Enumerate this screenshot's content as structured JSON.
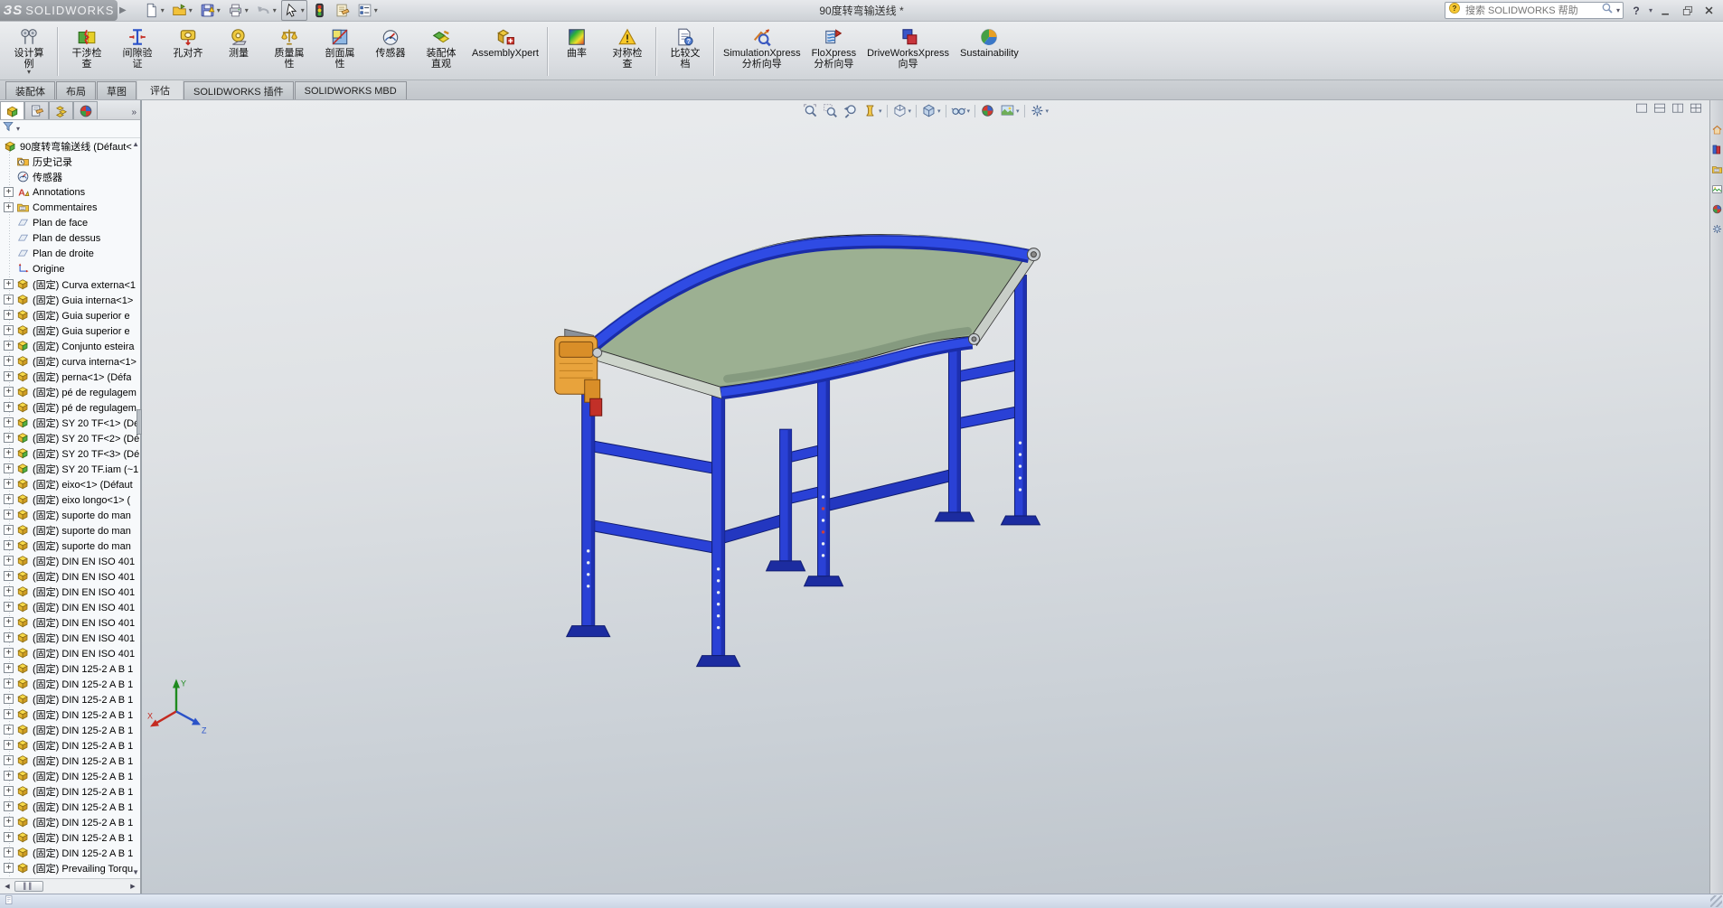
{
  "titlebar": {
    "logo_mark": "ЗS",
    "logo_text": "SOLIDWORKS",
    "document_title": "90度转弯输送线 *",
    "tools": [
      {
        "name": "new-document",
        "icon": "newdoc",
        "dropdown": true
      },
      {
        "name": "open",
        "icon": "open",
        "dropdown": true
      },
      {
        "name": "save",
        "icon": "save",
        "dropdown": true
      },
      {
        "name": "print",
        "icon": "print",
        "dropdown": true
      },
      {
        "name": "undo",
        "icon": "undo",
        "dropdown": true
      },
      {
        "name": "select",
        "icon": "cursor",
        "dropdown": true,
        "pressed": true
      },
      {
        "name": "rebuild",
        "icon": "rebuild",
        "dropdown": false
      },
      {
        "name": "file-properties",
        "icon": "fileprops",
        "dropdown": false
      },
      {
        "name": "options",
        "icon": "options",
        "dropdown": true
      }
    ],
    "search": {
      "placeholder": "搜索 SOLIDWORKS 帮助"
    },
    "help_label": "?"
  },
  "ribbon": {
    "buttons": [
      {
        "name": "design-study",
        "lines": [
          "设计算",
          "例"
        ],
        "icon": "designstudy",
        "flyout": true,
        "sep_after": true
      },
      {
        "name": "interference-check",
        "lines": [
          "干涉检",
          "查"
        ],
        "icon": "interfer"
      },
      {
        "name": "clearance-verify",
        "lines": [
          "间隙验",
          "证"
        ],
        "icon": "clearance"
      },
      {
        "name": "hole-alignment",
        "lines": [
          "孔对齐"
        ],
        "icon": "holealign"
      },
      {
        "name": "measure",
        "lines": [
          "测量"
        ],
        "icon": "measure"
      },
      {
        "name": "mass-properties",
        "lines": [
          "质量属",
          "性"
        ],
        "icon": "massprops"
      },
      {
        "name": "section-properties",
        "lines": [
          "剖面属",
          "性"
        ],
        "icon": "sectprops"
      },
      {
        "name": "sensor",
        "lines": [
          "传感器"
        ],
        "icon": "sensor"
      },
      {
        "name": "assembly-visualize",
        "lines": [
          "装配体",
          "直观"
        ],
        "icon": "asmvis"
      },
      {
        "name": "assembly-xpert",
        "lines": [
          "AssemblyXpert"
        ],
        "icon": "asmxpert",
        "sep_after": true
      },
      {
        "name": "curvature",
        "lines": [
          "曲率"
        ],
        "icon": "curvature"
      },
      {
        "name": "symmetry-check",
        "lines": [
          "对称检",
          "查"
        ],
        "icon": "symcheck",
        "sep_after": true
      },
      {
        "name": "compare-documents",
        "lines": [
          "比较文",
          "档"
        ],
        "icon": "comparedoc",
        "sep_after": true
      },
      {
        "name": "simulationxpress-wizard",
        "lines": [
          "SimulationXpress",
          "分析向导"
        ],
        "icon": "simx"
      },
      {
        "name": "floxpress-wizard",
        "lines": [
          "FloXpress",
          "分析向导"
        ],
        "icon": "flox"
      },
      {
        "name": "driveworksxpress-wizard",
        "lines": [
          "DriveWorksXpress",
          "向导"
        ],
        "icon": "driveworks"
      },
      {
        "name": "sustainability",
        "lines": [
          "Sustainability"
        ],
        "icon": "sustain"
      }
    ]
  },
  "tabs": [
    {
      "label": "装配体"
    },
    {
      "label": "布局"
    },
    {
      "label": "草图"
    },
    {
      "label": "评估",
      "active": true
    },
    {
      "label": "SOLIDWORKS 插件"
    },
    {
      "label": "SOLIDWORKS MBD"
    }
  ],
  "feature_panel": {
    "more_label": "»",
    "tabs": [
      "featuremanager-tree",
      "propertymanager",
      "configurationmanager",
      "displaymanager"
    ],
    "tree": {
      "root": {
        "label": "90度转弯输送线 (Défaut<",
        "icon": "trAsm"
      },
      "items": [
        {
          "label": "历史记录",
          "icon": "trHistory"
        },
        {
          "label": "传感器",
          "icon": "trSensor"
        },
        {
          "label": "Annotations",
          "icon": "trAnnot",
          "expand": true
        },
        {
          "label": "Commentaires",
          "icon": "trFolder",
          "expand": true
        },
        {
          "label": "Plan de face",
          "icon": "trPlane"
        },
        {
          "label": "Plan de dessus",
          "icon": "trPlane"
        },
        {
          "label": "Plan de droite",
          "icon": "trPlane"
        },
        {
          "label": "Origine",
          "icon": "trOrigin"
        },
        {
          "label": "(固定) Curva externa<1",
          "icon": "trPart",
          "expand": true
        },
        {
          "label": "(固定) Guia interna<1>",
          "icon": "trPart",
          "expand": true
        },
        {
          "label": "(固定) Guia superior e",
          "icon": "trPart",
          "expand": true
        },
        {
          "label": "(固定) Guia superior e",
          "icon": "trPart",
          "expand": true
        },
        {
          "label": "(固定) Conjunto esteira",
          "icon": "trSub",
          "expand": true
        },
        {
          "label": "(固定) curva interna<1>",
          "icon": "trPart",
          "expand": true
        },
        {
          "label": "(固定) perna<1> (Défa",
          "icon": "trPart",
          "expand": true
        },
        {
          "label": "(固定) pé de regulagem",
          "icon": "trPart",
          "expand": true
        },
        {
          "label": "(固定) pé de regulagem",
          "icon": "trPart",
          "expand": true
        },
        {
          "label": "(固定) SY 20 TF<1> (Dé",
          "icon": "trSub",
          "expand": true
        },
        {
          "label": "(固定) SY 20 TF<2> (Dé",
          "icon": "trSub",
          "expand": true
        },
        {
          "label": "(固定) SY 20 TF<3> (Dé",
          "icon": "trSub",
          "expand": true
        },
        {
          "label": "(固定) SY 20 TF.iam (~1",
          "icon": "trSub",
          "expand": true
        },
        {
          "label": "(固定) eixo<1> (Défaut",
          "icon": "trPart",
          "expand": true
        },
        {
          "label": "(固定) eixo longo<1> (",
          "icon": "trPart",
          "expand": true
        },
        {
          "label": "(固定) suporte do man",
          "icon": "trPart",
          "expand": true
        },
        {
          "label": "(固定) suporte do man",
          "icon": "trPart",
          "expand": true
        },
        {
          "label": "(固定) suporte do man",
          "icon": "trPart",
          "expand": true
        },
        {
          "label": "(固定) DIN EN ISO 401",
          "icon": "trPart",
          "expand": true
        },
        {
          "label": "(固定) DIN EN ISO 401",
          "icon": "trPart",
          "expand": true
        },
        {
          "label": "(固定) DIN EN ISO 401",
          "icon": "trPart",
          "expand": true
        },
        {
          "label": "(固定) DIN EN ISO 401",
          "icon": "trPart",
          "expand": true
        },
        {
          "label": "(固定) DIN EN ISO 401",
          "icon": "trPart",
          "expand": true
        },
        {
          "label": "(固定) DIN EN ISO 401",
          "icon": "trPart",
          "expand": true
        },
        {
          "label": "(固定) DIN EN ISO 401",
          "icon": "trPart",
          "expand": true
        },
        {
          "label": "(固定) DIN 125-2 A B 1",
          "icon": "trPart",
          "expand": true
        },
        {
          "label": "(固定) DIN 125-2 A B 1",
          "icon": "trPart",
          "expand": true
        },
        {
          "label": "(固定) DIN 125-2 A B 1",
          "icon": "trPart",
          "expand": true
        },
        {
          "label": "(固定) DIN 125-2 A B 1",
          "icon": "trPart",
          "expand": true
        },
        {
          "label": "(固定) DIN 125-2 A B 1",
          "icon": "trPart",
          "expand": true
        },
        {
          "label": "(固定) DIN 125-2 A B 1",
          "icon": "trPart",
          "expand": true
        },
        {
          "label": "(固定) DIN 125-2 A B 1",
          "icon": "trPart",
          "expand": true
        },
        {
          "label": "(固定) DIN 125-2 A B 1",
          "icon": "trPart",
          "expand": true
        },
        {
          "label": "(固定) DIN 125-2 A B 1",
          "icon": "trPart",
          "expand": true
        },
        {
          "label": "(固定) DIN 125-2 A B 1",
          "icon": "trPart",
          "expand": true
        },
        {
          "label": "(固定) DIN 125-2 A B 1",
          "icon": "trPart",
          "expand": true
        },
        {
          "label": "(固定) DIN 125-2 A B 1",
          "icon": "trPart",
          "expand": true
        },
        {
          "label": "(固定) DIN 125-2 A B 1",
          "icon": "trPart",
          "expand": true
        },
        {
          "label": "(固定) Prevailing Torqu",
          "icon": "trPart",
          "expand": true
        }
      ]
    }
  },
  "headsup": [
    {
      "name": "zoom-to-fit",
      "icon": "hzFit"
    },
    {
      "name": "zoom-to-area",
      "icon": "hzArea"
    },
    {
      "name": "previous-view",
      "icon": "hzPrev"
    },
    {
      "name": "section-view",
      "icon": "hzSection",
      "dropdown": true,
      "sep_after": true
    },
    {
      "name": "view-orientation",
      "icon": "hzOrient",
      "dropdown": true,
      "sep_after": true
    },
    {
      "name": "display-style",
      "icon": "hzStyle",
      "dropdown": true,
      "sep_after": true
    },
    {
      "name": "hide-show-items",
      "icon": "hzHideShow",
      "dropdown": true,
      "sep_after": true
    },
    {
      "name": "edit-appearance",
      "icon": "hzAppear"
    },
    {
      "name": "apply-scene",
      "icon": "hzScene",
      "dropdown": true,
      "sep_after": true
    },
    {
      "name": "view-settings",
      "icon": "hzSettings",
      "dropdown": true
    }
  ],
  "viewport_buttons": [
    "window-layout-single",
    "window-layout-two-horizontal",
    "window-layout-two-vertical",
    "window-layout-four"
  ],
  "taskpane_tabs": [
    "solidworks-resources",
    "design-library",
    "file-explorer",
    "view-palette",
    "appearances",
    "custom-properties"
  ],
  "triad": {
    "x": "X",
    "y": "Y",
    "z": "Z"
  },
  "colors": {
    "frame_blue": "#2A41D6",
    "frame_blue_dark": "#1A2CA0",
    "belt_green": "#9CB092",
    "belt_highlight": "#C8D6C0",
    "motor_orange": "#E8A33C",
    "red_accent": "#C23028",
    "viewport_top": "#EAECEE",
    "viewport_bottom": "#BCC3CA"
  }
}
